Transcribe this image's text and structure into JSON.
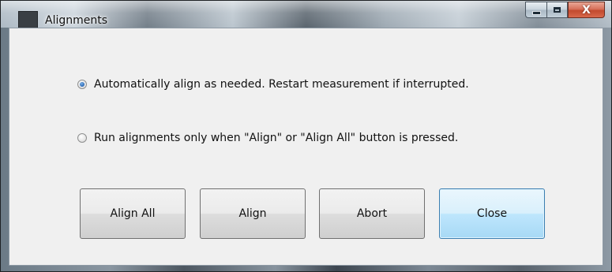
{
  "window": {
    "title": "Alignments",
    "caption_buttons": {
      "minimize_icon": "minimize-icon",
      "maximize_icon": "maximize-icon",
      "close_icon": "close-icon",
      "close_glyph": "X"
    }
  },
  "options": [
    {
      "label": "Automatically align as needed. Restart measurement if interrupted.",
      "selected": true
    },
    {
      "label": "Run alignments only when \"Align\" or \"Align All\" button is pressed.",
      "selected": false
    }
  ],
  "buttons": {
    "align_all": "Align All",
    "align": "Align",
    "abort": "Abort",
    "close": "Close"
  },
  "colors": {
    "default_button_border": "#3c7fb1",
    "dialog_background": "#f0f0f0",
    "close_caption": "#c24a2e"
  }
}
